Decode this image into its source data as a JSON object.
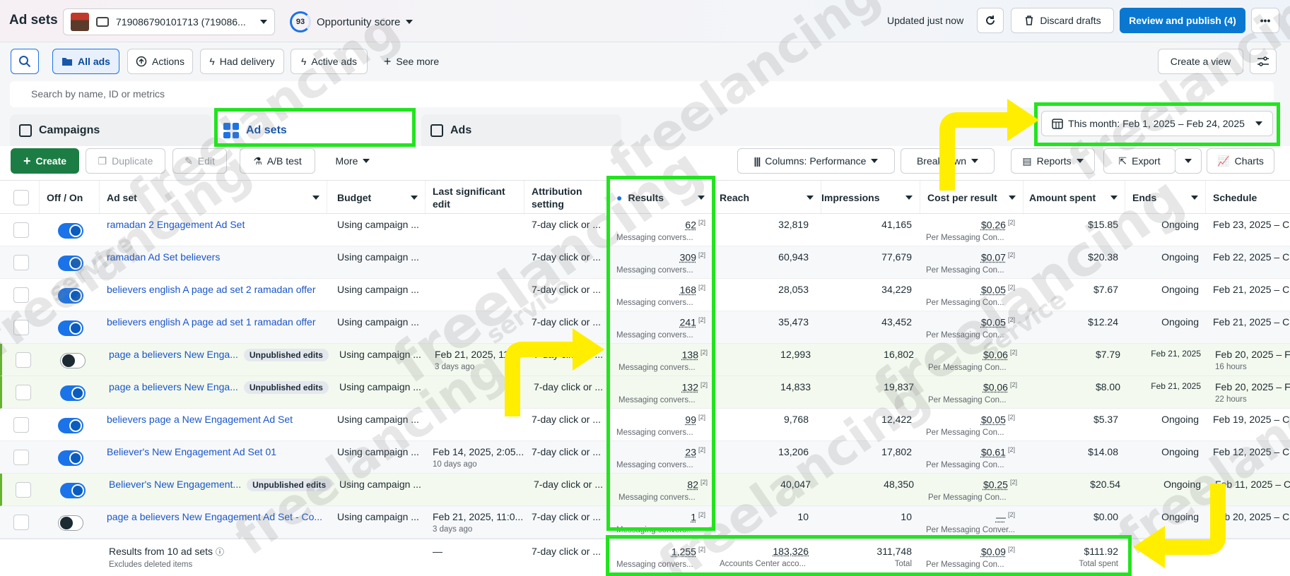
{
  "header": {
    "title": "Ad sets",
    "account": "719086790101713 (719086...",
    "opportunity_score": "93",
    "opportunity_label": "Opportunity score",
    "updated": "Updated just now",
    "discard_label": "Discard drafts",
    "publish_label": "Review and publish (4)"
  },
  "filters": {
    "all_ads": "All ads",
    "actions": "Actions",
    "had_delivery": "Had delivery",
    "active_ads": "Active ads",
    "see_more": "See more",
    "create_view": "Create a view"
  },
  "search": {
    "placeholder": "Search by name, ID or metrics"
  },
  "tabs": [
    {
      "label": "Campaigns"
    },
    {
      "label": "Ad sets"
    },
    {
      "label": "Ads"
    }
  ],
  "date_range": "This month: Feb 1, 2025 – Feb 24, 2025",
  "toolbar": {
    "create": "Create",
    "duplicate": "Duplicate",
    "edit": "Edit",
    "ab_test": "A/B test",
    "more": "More",
    "columns": "Columns: Performance",
    "breakdown": "Breakdown",
    "reports": "Reports",
    "export": "Export",
    "charts": "Charts"
  },
  "columns": {
    "onoff": "Off / On",
    "adset": "Ad set",
    "budget": "Budget",
    "last_edit": "Last significant edit",
    "attribution": "Attribution setting",
    "results": "Results",
    "reach": "Reach",
    "impressions": "Impressions",
    "cpr": "Cost per result",
    "spent": "Amount spent",
    "ends": "Ends",
    "schedule": "Schedule"
  },
  "rows": [
    {
      "name": "ramadan 2 Engagement Ad Set",
      "badge": "",
      "on": true,
      "budget": "Using campaign ...",
      "edit": "",
      "edit_sub": "",
      "attr": "7-day click or ...",
      "results": "62",
      "results_sub": "Messaging convers...",
      "reach": "32,819",
      "impr": "41,165",
      "cpr": "$0.26",
      "cpr_sub": "Per Messaging Con...",
      "spent": "$15.85",
      "ends": "Ongoing",
      "ends_sub": "",
      "sched": "Feb 23, 2025 – C",
      "sched_sub": ""
    },
    {
      "name": "ramadan Ad Set believers",
      "badge": "",
      "on": true,
      "budget": "Using campaign ...",
      "edit": "",
      "edit_sub": "",
      "attr": "7-day click or ...",
      "results": "309",
      "results_sub": "Messaging convers...",
      "reach": "60,943",
      "impr": "77,679",
      "cpr": "$0.07",
      "cpr_sub": "Per Messaging Con...",
      "spent": "$20.38",
      "ends": "Ongoing",
      "ends_sub": "",
      "sched": "Feb 22, 2025 – C",
      "sched_sub": ""
    },
    {
      "name": "believers english A page ad set 2 ramadan offer",
      "badge": "",
      "on": true,
      "budget": "Using campaign ...",
      "edit": "",
      "edit_sub": "",
      "attr": "7-day click or ...",
      "results": "168",
      "results_sub": "Messaging convers...",
      "reach": "28,053",
      "impr": "34,229",
      "cpr": "$0.05",
      "cpr_sub": "Per Messaging Con...",
      "spent": "$7.67",
      "ends": "Ongoing",
      "ends_sub": "",
      "sched": "Feb 21, 2025 – C",
      "sched_sub": ""
    },
    {
      "name": "believers english A page ad set 1 ramadan offer",
      "badge": "",
      "on": true,
      "budget": "Using campaign ...",
      "edit": "",
      "edit_sub": "",
      "attr": "7-day click or ...",
      "results": "241",
      "results_sub": "Messaging convers...",
      "reach": "35,473",
      "impr": "43,452",
      "cpr": "$0.05",
      "cpr_sub": "Per Messaging Con...",
      "spent": "$12.24",
      "ends": "Ongoing",
      "ends_sub": "",
      "sched": "Feb 21, 2025 – C",
      "sched_sub": ""
    },
    {
      "name": "page a believers New Enga...",
      "badge": "Unpublished edits",
      "on": false,
      "budget": "Using campaign ...",
      "edit": "Feb 21, 2025, 11:...",
      "edit_sub": "3 days ago",
      "attr": "7-day click or ...",
      "results": "138",
      "results_sub": "Messaging convers...",
      "reach": "12,993",
      "impr": "16,802",
      "cpr": "$0.06",
      "cpr_sub": "Per Messaging Con...",
      "spent": "$7.79",
      "ends": "Feb 21, 2025",
      "ends_sub": "",
      "sched": "Feb 20, 2025 – F",
      "sched_sub": "16 hours"
    },
    {
      "name": "page a believers New Enga...",
      "badge": "Unpublished edits",
      "on": true,
      "budget": "Using campaign ...",
      "edit": "",
      "edit_sub": "",
      "attr": "7-day click or ...",
      "results": "132",
      "results_sub": "Messaging convers...",
      "reach": "14,833",
      "impr": "19,837",
      "cpr": "$0.06",
      "cpr_sub": "Per Messaging Con...",
      "spent": "$8.00",
      "ends": "Feb 21, 2025",
      "ends_sub": "",
      "sched": "Feb 20, 2025 – F",
      "sched_sub": "22 hours"
    },
    {
      "name": "believers page a New Engagement Ad Set",
      "badge": "",
      "on": true,
      "budget": "Using campaign ...",
      "edit": "",
      "edit_sub": "",
      "attr": "7-day click or ...",
      "results": "99",
      "results_sub": "Messaging convers...",
      "reach": "9,768",
      "impr": "12,422",
      "cpr": "$0.05",
      "cpr_sub": "Per Messaging Con...",
      "spent": "$5.37",
      "ends": "Ongoing",
      "ends_sub": "",
      "sched": "Feb 19, 2025 – C",
      "sched_sub": ""
    },
    {
      "name": "Believer's New Engagement Ad Set 01",
      "badge": "",
      "on": true,
      "budget": "Using campaign ...",
      "edit": "Feb 14, 2025, 2:05...",
      "edit_sub": "10 days ago",
      "attr": "7-day click or ...",
      "results": "23",
      "results_sub": "Messaging convers...",
      "reach": "13,206",
      "impr": "17,802",
      "cpr": "$0.61",
      "cpr_sub": "Per Messaging Con...",
      "spent": "$14.08",
      "ends": "Ongoing",
      "ends_sub": "",
      "sched": "Feb 12, 2025 – C",
      "sched_sub": ""
    },
    {
      "name": "Believer's New Engagement...",
      "badge": "Unpublished edits",
      "on": true,
      "budget": "Using campaign ...",
      "edit": "",
      "edit_sub": "",
      "attr": "7-day click or ...",
      "results": "82",
      "results_sub": "Messaging convers...",
      "reach": "40,047",
      "impr": "48,350",
      "cpr": "$0.25",
      "cpr_sub": "Per Messaging Con...",
      "spent": "$20.54",
      "ends": "Ongoing",
      "ends_sub": "",
      "sched": "Feb 11, 2025 – C",
      "sched_sub": ""
    },
    {
      "name": "page a believers New Engagement Ad Set - Co...",
      "badge": "",
      "on": false,
      "budget": "Using campaign ...",
      "edit": "Feb 21, 2025, 11:0...",
      "edit_sub": "3 days ago",
      "attr": "7-day click or ...",
      "results": "1",
      "results_sub": "Messaging convers...",
      "reach": "10",
      "impr": "10",
      "cpr": "—",
      "cpr_sub": "Per Messaging Conver...",
      "spent": "$0.00",
      "ends": "Ongoing",
      "ends_sub": "",
      "sched": "Feb 20, 2025 – C",
      "sched_sub": ""
    }
  ],
  "totals": {
    "label": "Results from 10 ad sets",
    "sub": "Excludes deleted items",
    "edit": "—",
    "attr": "7-day click or ...",
    "results": "1,255",
    "results_sub": "Messaging convers...",
    "reach": "183,326",
    "reach_sub": "Accounts Center acco...",
    "impr": "311,748",
    "impr_sub": "Total",
    "cpr": "$0.09",
    "cpr_sub": "Per Messaging Con...",
    "spent": "$111.92",
    "spent_sub": "Total spent"
  },
  "watermark": {
    "main": "freelancing",
    "sub": "service"
  },
  "colors": {
    "highlight": "#22e41e",
    "arrow": "#ffee00",
    "primary": "#0a78d0",
    "create": "#1c7d44"
  }
}
